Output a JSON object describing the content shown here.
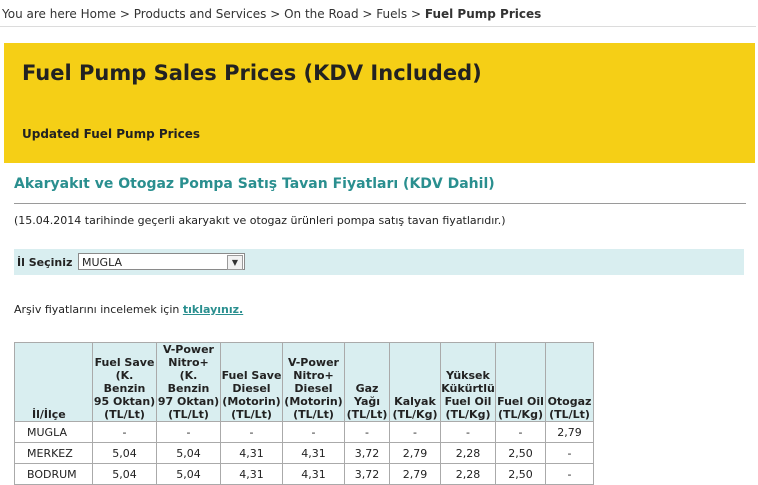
{
  "breadcrumb": {
    "prefix": "You are here",
    "items": [
      "Home",
      "Products and Services",
      "On the Road",
      "Fuels"
    ],
    "separator": ">",
    "current": "Fuel Pump Prices"
  },
  "hero": {
    "title": "Fuel Pump Sales Prices (KDV Included)",
    "subtitle": "Updated Fuel Pump Prices",
    "background_color": "#f5cf16"
  },
  "section": {
    "title": "Akaryakıt ve Otogaz Pompa Satış Tavan Fiyatları (KDV Dahil)",
    "title_color": "#2a8f8f",
    "note": "(15.04.2014 tarihinde geçerli akaryakıt ve otogaz ürünleri pompa satış tavan fiyatlarıdır.)"
  },
  "city_select": {
    "label": "İl Seçiniz",
    "value": "MUGLA"
  },
  "archive": {
    "text": "Arşiv fiyatlarını incelemek için",
    "link": "tıklayınız."
  },
  "table": {
    "headers": [
      [
        "İl/İlçe"
      ],
      [
        "Fuel Save",
        "(K. Benzin",
        "95 Oktan)",
        "(TL/Lt)"
      ],
      [
        "V-Power",
        "Nitro+",
        "(K. Benzin",
        "97 Oktan)",
        "(TL/Lt)"
      ],
      [
        "Fuel Save",
        "Diesel",
        "(Motorin)",
        "(TL/Lt)"
      ],
      [
        "V-Power",
        "Nitro+",
        "Diesel",
        "(Motorin)",
        "(TL/Lt)"
      ],
      [
        "Gaz",
        "Yağı",
        "(TL/Lt)"
      ],
      [
        "Kalyak",
        "(TL/Kg)"
      ],
      [
        "Yüksek",
        "Kükürtlü",
        "Fuel Oil",
        "(TL/Kg)"
      ],
      [
        "Fuel Oil",
        "(TL/Kg)"
      ],
      [
        "Otogaz",
        "(TL/Lt)"
      ]
    ],
    "rows": [
      [
        "MUGLA",
        "-",
        "-",
        "-",
        "-",
        "-",
        "-",
        "-",
        "-",
        "2,79"
      ],
      [
        "MERKEZ",
        "5,04",
        "5,04",
        "4,31",
        "4,31",
        "3,72",
        "2,79",
        "2,28",
        "2,50",
        "-"
      ],
      [
        "BODRUM",
        "5,04",
        "5,04",
        "4,31",
        "4,31",
        "3,72",
        "2,79",
        "2,28",
        "2,50",
        "-"
      ]
    ],
    "header_bg": "#d9eef0"
  },
  "icons": {
    "select_arrow": "chevron-down-icon"
  }
}
